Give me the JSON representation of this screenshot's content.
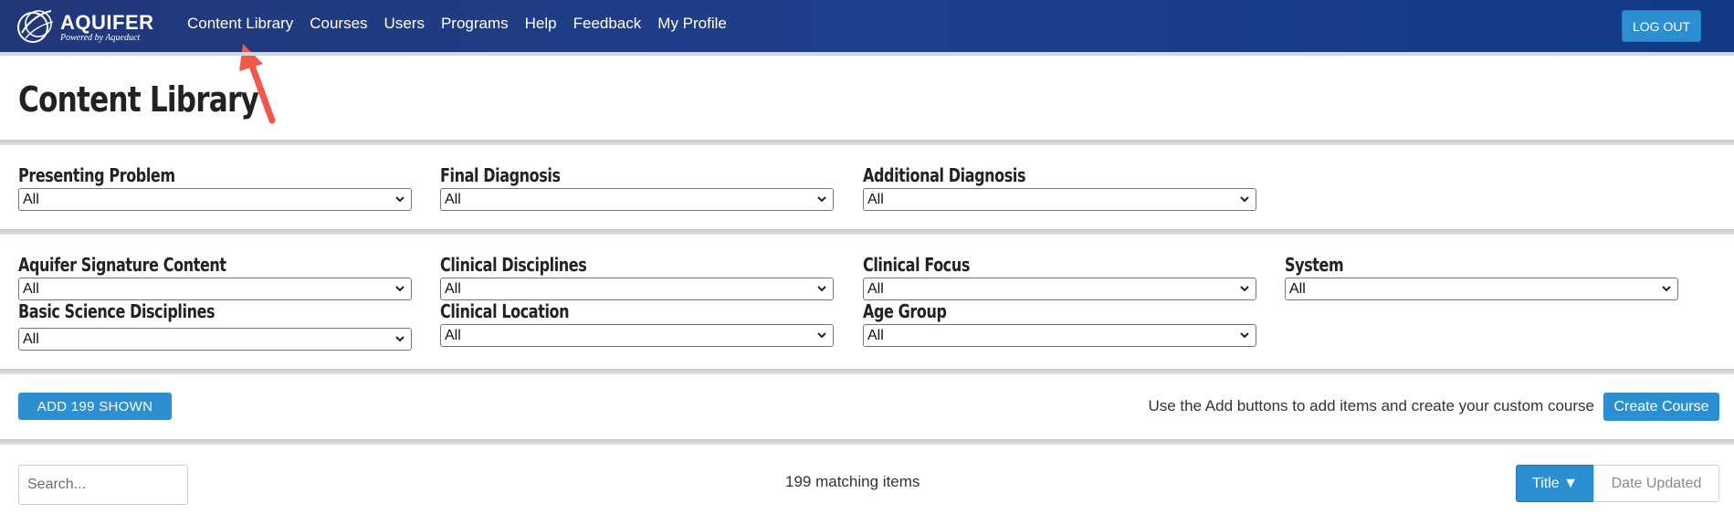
{
  "brand": {
    "name": "AQUIFER",
    "tagline": "Powered by Aqueduct"
  },
  "nav": {
    "items": [
      {
        "label": "Content Library",
        "name": "nav-content-library"
      },
      {
        "label": "Courses",
        "name": "nav-courses"
      },
      {
        "label": "Users",
        "name": "nav-users"
      },
      {
        "label": "Programs",
        "name": "nav-programs"
      },
      {
        "label": "Help",
        "name": "nav-help"
      },
      {
        "label": "Feedback",
        "name": "nav-feedback"
      },
      {
        "label": "My Profile",
        "name": "nav-my-profile"
      }
    ],
    "logout_label": "LOG OUT"
  },
  "page": {
    "title": "Content Library"
  },
  "filters_row1": [
    {
      "label": "Presenting Problem",
      "value": "All"
    },
    {
      "label": "Final Diagnosis",
      "value": "All"
    },
    {
      "label": "Additional Diagnosis",
      "value": "All"
    }
  ],
  "filters_row2": [
    {
      "label": "Aquifer Signature Content",
      "value": "All"
    },
    {
      "label": "Clinical Disciplines",
      "value": "All"
    },
    {
      "label": "Clinical Focus",
      "value": "All"
    },
    {
      "label": "System",
      "value": "All"
    }
  ],
  "filters_row3": [
    {
      "label": "Basic Science Disciplines",
      "value": "All"
    },
    {
      "label": "Clinical Location",
      "value": "All"
    },
    {
      "label": "Age Group",
      "value": "All"
    }
  ],
  "actions": {
    "add_label": "ADD 199 SHOWN",
    "hint": "Use the Add buttons to add items and create your custom course",
    "create_label": "Create Course"
  },
  "results": {
    "search_placeholder": "Search...",
    "count_text": "199 matching items",
    "sort_title": "Title ▼",
    "sort_date": "Date Updated"
  },
  "colors": {
    "nav_bg": "#1e3f8c",
    "accent": "#2b8fd2",
    "annotation_arrow": "#f0594a"
  },
  "icons": {
    "logo": "aquifer-logo-icon",
    "select_caret": "chevron-down-icon",
    "annotation": "red-arrow-icon"
  }
}
